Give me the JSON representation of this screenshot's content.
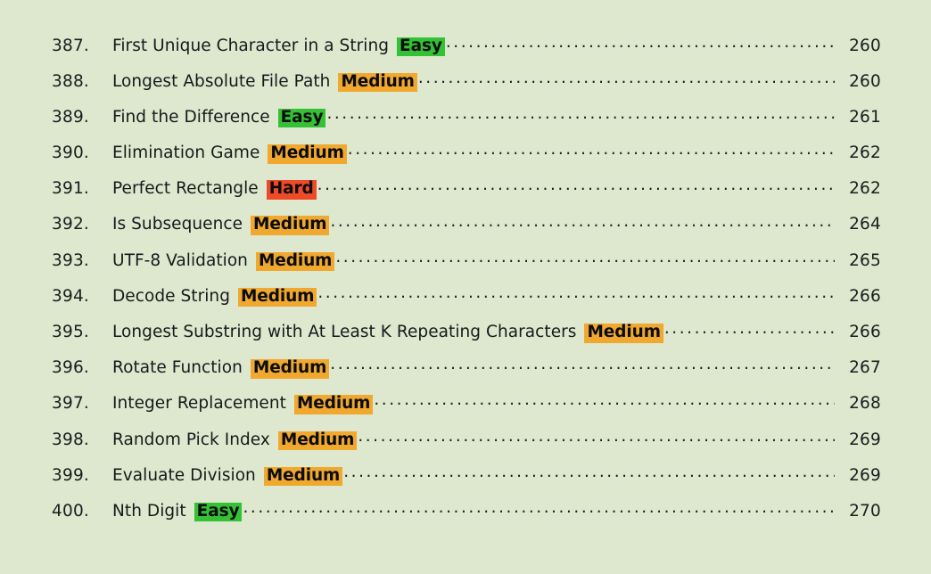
{
  "document": {
    "type": "table-of-contents",
    "background_color": "#dde8cf",
    "text_color": "#17191a"
  },
  "difficulty_colors": {
    "easy": "#35c135",
    "medium": "#f0a82e",
    "hard": "#ef4a26"
  },
  "entries": [
    {
      "number": "387.",
      "title": "First Unique Character in a String",
      "difficulty": "Easy",
      "level": "easy",
      "page": "260"
    },
    {
      "number": "388.",
      "title": "Longest Absolute File Path",
      "difficulty": "Medium",
      "level": "medium",
      "page": "260"
    },
    {
      "number": "389.",
      "title": "Find the Difference",
      "difficulty": "Easy",
      "level": "easy",
      "page": "261"
    },
    {
      "number": "390.",
      "title": "Elimination Game",
      "difficulty": "Medium",
      "level": "medium",
      "page": "262"
    },
    {
      "number": "391.",
      "title": "Perfect Rectangle",
      "difficulty": "Hard",
      "level": "hard",
      "page": "262"
    },
    {
      "number": "392.",
      "title": "Is Subsequence",
      "difficulty": "Medium",
      "level": "medium",
      "page": "264"
    },
    {
      "number": "393.",
      "title": "UTF-8 Validation",
      "difficulty": "Medium",
      "level": "medium",
      "page": "265"
    },
    {
      "number": "394.",
      "title": "Decode String",
      "difficulty": "Medium",
      "level": "medium",
      "page": "266"
    },
    {
      "number": "395.",
      "title": "Longest Substring with At Least K Repeating Characters",
      "difficulty": "Medium",
      "level": "medium",
      "page": "266"
    },
    {
      "number": "396.",
      "title": "Rotate Function",
      "difficulty": "Medium",
      "level": "medium",
      "page": "267"
    },
    {
      "number": "397.",
      "title": "Integer Replacement",
      "difficulty": "Medium",
      "level": "medium",
      "page": "268"
    },
    {
      "number": "398.",
      "title": "Random Pick Index",
      "difficulty": "Medium",
      "level": "medium",
      "page": "269"
    },
    {
      "number": "399.",
      "title": "Evaluate Division",
      "difficulty": "Medium",
      "level": "medium",
      "page": "269"
    },
    {
      "number": "400.",
      "title": "Nth Digit",
      "difficulty": "Easy",
      "level": "easy",
      "page": "270"
    }
  ]
}
